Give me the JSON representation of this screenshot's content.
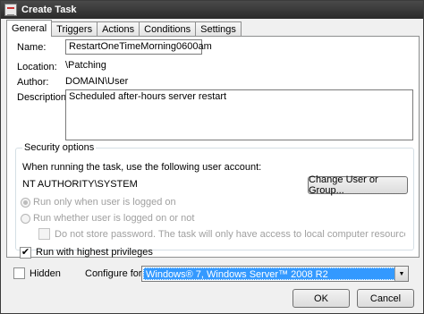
{
  "window": {
    "title": "Create Task"
  },
  "tabs": [
    {
      "label": "General"
    },
    {
      "label": "Triggers"
    },
    {
      "label": "Actions"
    },
    {
      "label": "Conditions"
    },
    {
      "label": "Settings"
    }
  ],
  "general": {
    "name_label": "Name:",
    "name_value": "RestartOneTimeMorning0600am",
    "location_label": "Location:",
    "location_value": "\\Patching",
    "author_label": "Author:",
    "author_value": "DOMAIN\\User",
    "description_label": "Description:",
    "description_value": "Scheduled after-hours server restart"
  },
  "security": {
    "group_title": "Security options",
    "account_prompt": "When running the task, use the following user account:",
    "account_value": "NT AUTHORITY\\SYSTEM",
    "change_button": "Change User or Group...",
    "radio_logged_on": "Run only when user is logged on",
    "radio_whether": "Run whether user is logged on or not",
    "no_store_password": "Do not store password.  The task will only have access to local computer resources.",
    "highest_privileges": "Run with highest privileges",
    "highest_privileges_checked": true
  },
  "footer": {
    "hidden_label": "Hidden",
    "hidden_checked": false,
    "configure_label": "Configure for:",
    "configure_value": "Windows® 7, Windows Server™ 2008 R2",
    "ok_button": "OK",
    "cancel_button": "Cancel"
  }
}
